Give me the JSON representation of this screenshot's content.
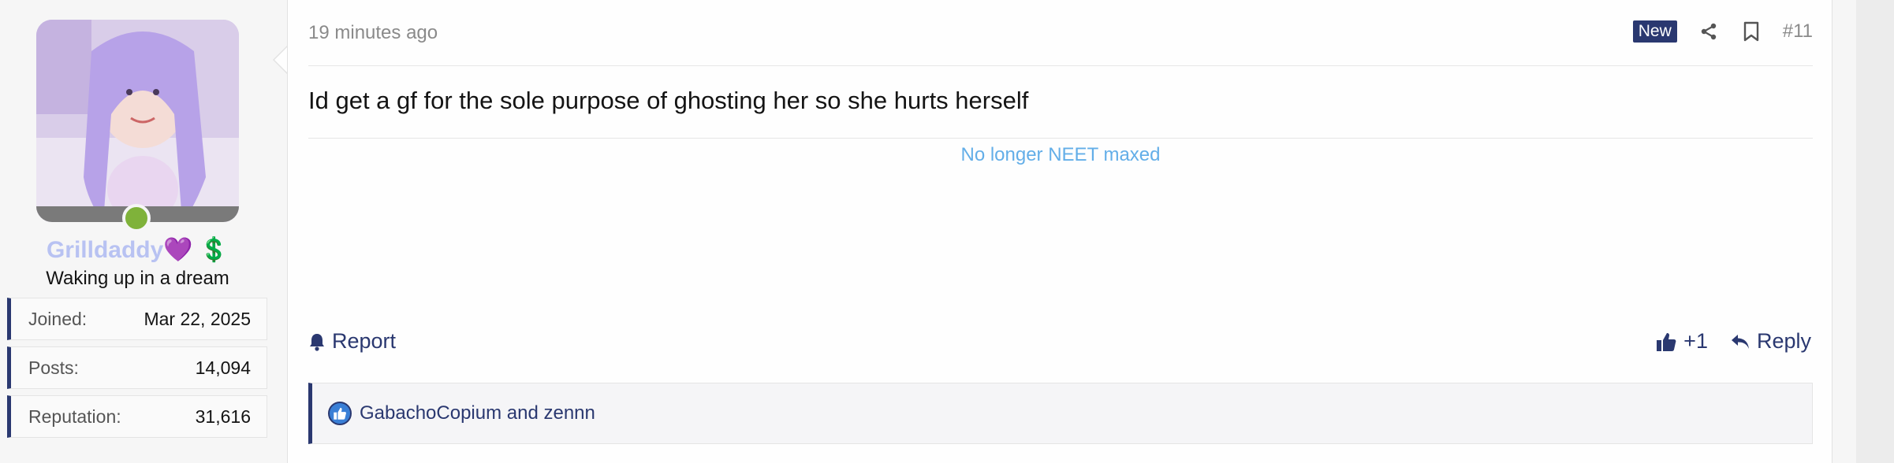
{
  "user": {
    "name": "Grilldaddy",
    "name_heart": "💜",
    "name_badge": "💲",
    "title": "Waking up in a dream",
    "online": true,
    "stats": [
      {
        "label": "Joined:",
        "value": "Mar 22, 2025"
      },
      {
        "label": "Posts:",
        "value": "14,094"
      },
      {
        "label": "Reputation:",
        "value": "31,616"
      }
    ]
  },
  "post": {
    "timestamp": "19 minutes ago",
    "new_badge": "New",
    "share_icon": "share-icon",
    "bookmark_icon": "bookmark-icon",
    "number": "#11",
    "message": "Id get a gf for the sole purpose of ghosting her so she hurts herself",
    "signature": "No longer NEET maxed",
    "actions": {
      "report_label": "Report",
      "like_label": "+1",
      "reply_label": "Reply"
    },
    "reactions_text": "GabachoCopium and zennn"
  },
  "colors": {
    "accent": "#2a3870",
    "signature": "#63aee8",
    "online": "#7fb23a",
    "username": "#b8c2f2"
  }
}
